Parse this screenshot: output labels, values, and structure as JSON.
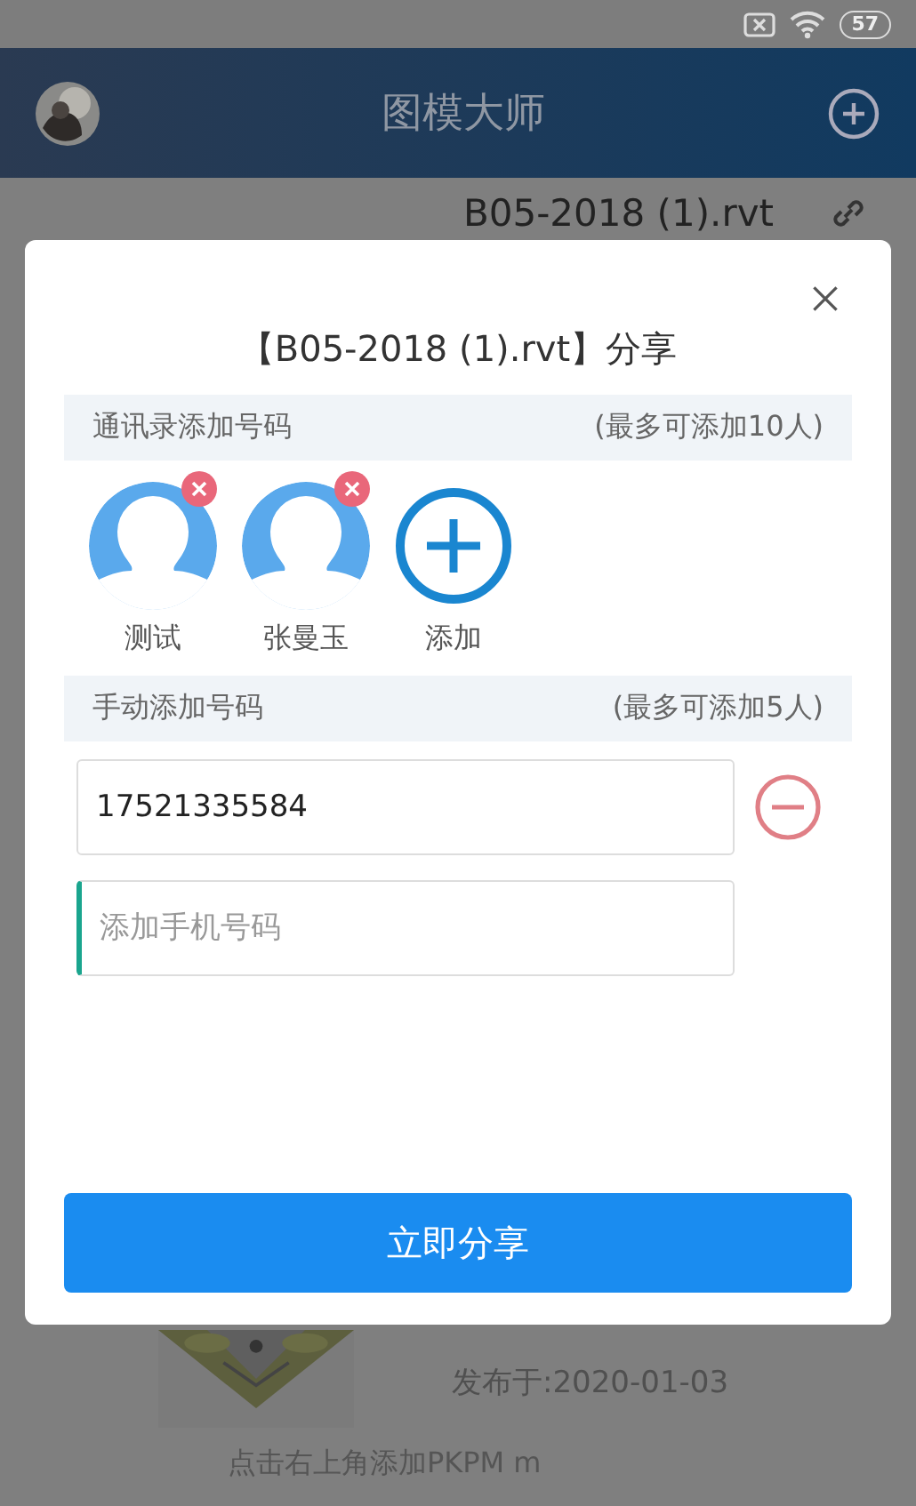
{
  "status_bar": {
    "battery": "57"
  },
  "header": {
    "title": "图模大师"
  },
  "card": {
    "file_name": "B05-2018 (1).rvt",
    "published": "发布于:2020-01-03"
  },
  "footer_hint": "点击右上角添加PKPM m",
  "dialog": {
    "title": "【B05-2018 (1).rvt】分享",
    "contacts_section": {
      "label": "通讯录添加号码",
      "limit": "(最多可添加10人)"
    },
    "contacts": [
      {
        "name": "测试"
      },
      {
        "name": "张曼玉"
      }
    ],
    "add_label": "添加",
    "manual_section": {
      "label": "手动添加号码",
      "limit": "(最多可添加5人)"
    },
    "phones": [
      {
        "value": "17521335584",
        "removable": true
      },
      {
        "placeholder": "添加手机号码",
        "focused": true,
        "removable": false
      }
    ],
    "share_button": "立即分享"
  }
}
